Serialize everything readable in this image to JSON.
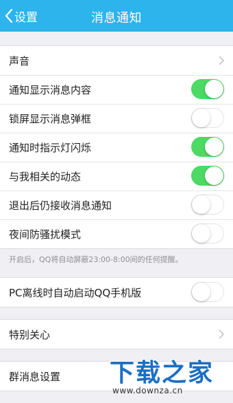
{
  "nav": {
    "back_label": "设置",
    "title": "消息通知"
  },
  "group_sound": {
    "rows": [
      {
        "label": "声音",
        "type": "link"
      },
      {
        "label": "通知显示消息内容",
        "type": "toggle",
        "on": true
      },
      {
        "label": "锁屏显示消息弹框",
        "type": "toggle",
        "on": false
      },
      {
        "label": "通知时指示灯闪烁",
        "type": "toggle",
        "on": true
      },
      {
        "label": "与我相关的动态",
        "type": "toggle",
        "on": true
      },
      {
        "label": "退出后仍接收消息通知",
        "type": "toggle",
        "on": false
      },
      {
        "label": "夜间防骚扰模式",
        "type": "toggle",
        "on": false
      }
    ]
  },
  "hint": "开启后，QQ将自动屏蔽23:00-8:00间的任何提醒。",
  "group_pc": {
    "rows": [
      {
        "label": "PC离线时自动启动QQ手机版",
        "type": "toggle",
        "on": false
      }
    ]
  },
  "group_special": {
    "rows": [
      {
        "label": "特别关心",
        "type": "link"
      }
    ]
  },
  "group_chat": {
    "rows": [
      {
        "label": "群消息设置",
        "type": "link"
      }
    ]
  },
  "watermark": {
    "main": "下载之家",
    "sub": "www.downza.cn"
  },
  "colors": {
    "nav_bg": "#2eb4ec",
    "toggle_on": "#4cd964",
    "page_bg": "#efeff4"
  },
  "icons": [
    "back-chevron-icon",
    "chevron-right-icon"
  ]
}
